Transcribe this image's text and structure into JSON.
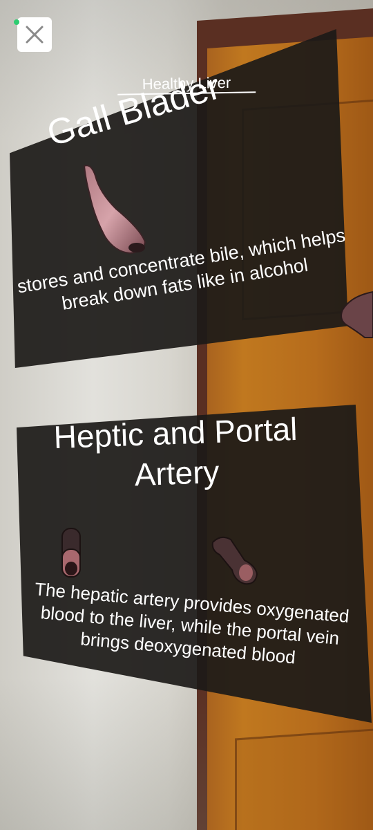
{
  "ar_view": {
    "header_title": "Healthy Liver",
    "gall_panel": {
      "title": "Gall Blader",
      "description": "stores and concentrate bile, which helps break down fats like in alcohol"
    },
    "heptic_panel": {
      "title": "Heptic and Portal Artery",
      "description": "The hepatic artery provides oxygenated blood to the liver, while the portal vein brings deoxygenated blood"
    }
  },
  "controls": {
    "close_icon": "close-icon",
    "status_indicator_color": "#2ecc71"
  },
  "colors": {
    "panel_background": "#1c1a18",
    "text": "#ffffff",
    "door": "#b66c1c"
  }
}
